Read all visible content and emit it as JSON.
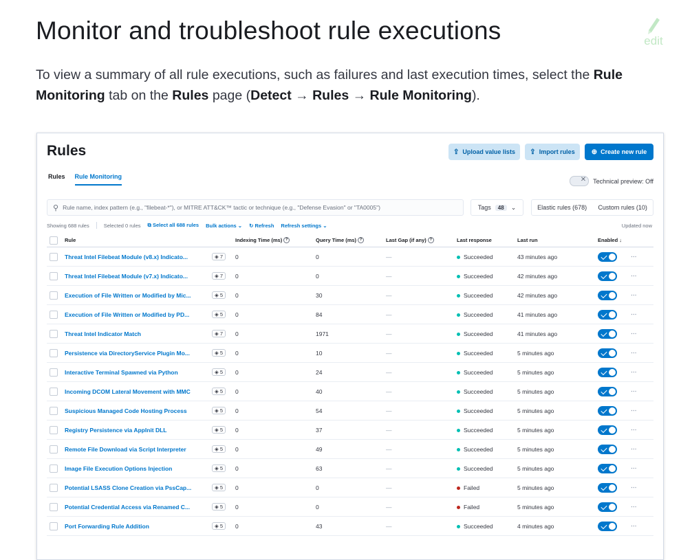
{
  "doc": {
    "title": "Monitor and troubleshoot rule executions",
    "edit_label": "edit",
    "intro": {
      "t1": "To view a summary of all rule executions, such as failures and last execution times, select the ",
      "b1": "Rule Monitoring",
      "t2": " tab on the ",
      "b2": "Rules",
      "t3": " page (",
      "b3": "Detect",
      "t4": " → ",
      "b4": "Rules",
      "t5": " → ",
      "b5": "Rule Monitoring",
      "t6": ")."
    }
  },
  "ui": {
    "page_title": "Rules",
    "buttons": {
      "upload": "Upload value lists",
      "import": "Import rules",
      "create": "Create new rule"
    },
    "tabs": [
      "Rules",
      "Rule Monitoring"
    ],
    "tech_preview": "Technical preview: Off",
    "search_placeholder": "Rule name, index pattern (e.g., \"filebeat-*\"), or MITRE ATT&CK™ tactic or technique (e.g., \"Defense Evasion\" or \"TA0005\")",
    "tags_label": "Tags",
    "tags_count": "48",
    "elastic_rules": "Elastic rules (678)",
    "custom_rules": "Custom rules (10)",
    "showing": "Showing 688 rules",
    "selected": "Selected 0 rules",
    "select_all": "Select all 688 rules",
    "bulk": "Bulk actions",
    "refresh": "Refresh",
    "refresh_settings": "Refresh settings",
    "updated": "Updated now",
    "columns": [
      "Rule",
      "Indexing Time (ms)",
      "Query Time (ms)",
      "Last Gap (if any)",
      "Last response",
      "Last run",
      "Enabled"
    ],
    "rows": [
      {
        "rule": "Threat Intel Filebeat Module (v8.x) Indicato...",
        "ver": "7",
        "idx": "0",
        "query": "0",
        "gap": "—",
        "response": "Succeeded",
        "last_run": "43 minutes ago"
      },
      {
        "rule": "Threat Intel Filebeat Module (v7.x) Indicato...",
        "ver": "7",
        "idx": "0",
        "query": "0",
        "gap": "—",
        "response": "Succeeded",
        "last_run": "42 minutes ago"
      },
      {
        "rule": "Execution of File Written or Modified by Mic...",
        "ver": "5",
        "idx": "0",
        "query": "30",
        "gap": "—",
        "response": "Succeeded",
        "last_run": "42 minutes ago"
      },
      {
        "rule": "Execution of File Written or Modified by PD...",
        "ver": "5",
        "idx": "0",
        "query": "84",
        "gap": "—",
        "response": "Succeeded",
        "last_run": "41 minutes ago"
      },
      {
        "rule": "Threat Intel Indicator Match",
        "ver": "7",
        "idx": "0",
        "query": "1971",
        "gap": "—",
        "response": "Succeeded",
        "last_run": "41 minutes ago"
      },
      {
        "rule": "Persistence via DirectoryService Plugin Mo...",
        "ver": "5",
        "idx": "0",
        "query": "10",
        "gap": "—",
        "response": "Succeeded",
        "last_run": "5 minutes ago"
      },
      {
        "rule": "Interactive Terminal Spawned via Python",
        "ver": "5",
        "idx": "0",
        "query": "24",
        "gap": "—",
        "response": "Succeeded",
        "last_run": "5 minutes ago"
      },
      {
        "rule": "Incoming DCOM Lateral Movement with MMC",
        "ver": "5",
        "idx": "0",
        "query": "40",
        "gap": "—",
        "response": "Succeeded",
        "last_run": "5 minutes ago"
      },
      {
        "rule": "Suspicious Managed Code Hosting Process",
        "ver": "5",
        "idx": "0",
        "query": "54",
        "gap": "—",
        "response": "Succeeded",
        "last_run": "5 minutes ago"
      },
      {
        "rule": "Registry Persistence via AppInit DLL",
        "ver": "5",
        "idx": "0",
        "query": "37",
        "gap": "—",
        "response": "Succeeded",
        "last_run": "5 minutes ago"
      },
      {
        "rule": "Remote File Download via Script Interpreter",
        "ver": "5",
        "idx": "0",
        "query": "49",
        "gap": "—",
        "response": "Succeeded",
        "last_run": "5 minutes ago"
      },
      {
        "rule": "Image File Execution Options Injection",
        "ver": "5",
        "idx": "0",
        "query": "63",
        "gap": "—",
        "response": "Succeeded",
        "last_run": "5 minutes ago"
      },
      {
        "rule": "Potential LSASS Clone Creation via PssCap...",
        "ver": "5",
        "idx": "0",
        "query": "0",
        "gap": "—",
        "response": "Failed",
        "last_run": "5 minutes ago"
      },
      {
        "rule": "Potential Credential Access via Renamed C...",
        "ver": "5",
        "idx": "0",
        "query": "0",
        "gap": "—",
        "response": "Failed",
        "last_run": "5 minutes ago"
      },
      {
        "rule": "Port Forwarding Rule Addition",
        "ver": "5",
        "idx": "0",
        "query": "43",
        "gap": "—",
        "response": "Succeeded",
        "last_run": "4 minutes ago"
      }
    ]
  },
  "colors": {
    "success": "#00bfb3",
    "danger": "#bd271e",
    "accent": "#0077cc"
  },
  "icons": [
    "pencil-icon",
    "upload-icon",
    "import-icon",
    "plus-circle-icon",
    "search-icon",
    "chevron-down-icon",
    "refresh-icon",
    "select-all-icon",
    "help-icon",
    "sort-down-icon",
    "checkmark-icon",
    "actions-menu-icon"
  ]
}
